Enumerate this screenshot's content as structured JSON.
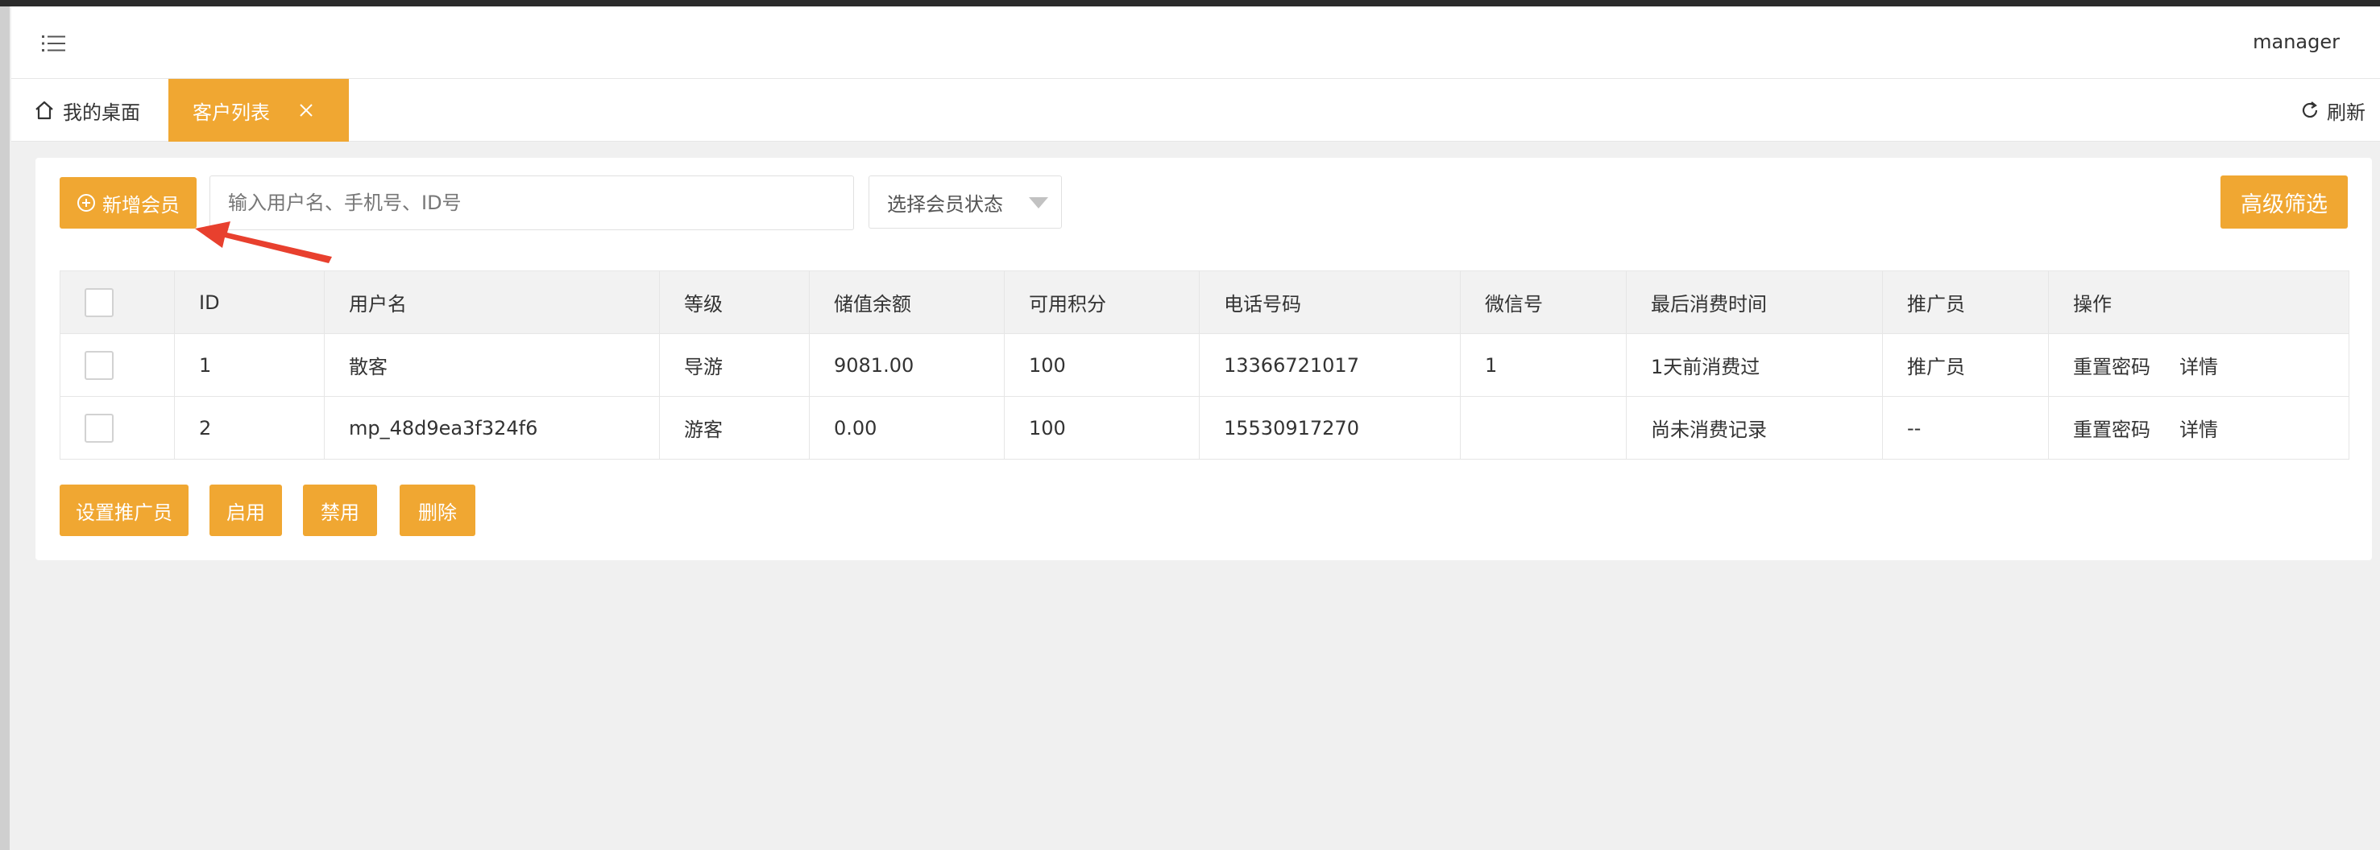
{
  "header": {
    "user_name": "manager",
    "menu_icon": "list-icon"
  },
  "tabs": {
    "home_label": "我的桌面",
    "active_label": "客户列表",
    "refresh_label": "刷新"
  },
  "toolbar": {
    "add_label": "新增会员",
    "search_placeholder": "输入用户名、手机号、ID号",
    "status_placeholder": "选择会员状态",
    "advanced_label": "高级筛选"
  },
  "table": {
    "columns": [
      "ID",
      "用户名",
      "等级",
      "储值余额",
      "可用积分",
      "电话号码",
      "微信号",
      "最后消费时间",
      "推广员",
      "操作"
    ],
    "rows": [
      {
        "id": "1",
        "username": "散客",
        "level": "导游",
        "balance": "9081.00",
        "points": "100",
        "phone": "13366721017",
        "wechat": "1",
        "last_time": "1天前消费过",
        "promoter": "推广员",
        "reset": "重置密码",
        "detail": "详情"
      },
      {
        "id": "2",
        "username": "mp_48d9ea3f324f6",
        "level": "游客",
        "balance": "0.00",
        "points": "100",
        "phone": "15530917270",
        "wechat": "",
        "last_time": "尚未消费记录",
        "promoter": "--",
        "reset": "重置密码",
        "detail": "详情"
      }
    ]
  },
  "bottom": {
    "set_promoter": "设置推广员",
    "enable": "启用",
    "disable": "禁用",
    "delete": "删除"
  },
  "colors": {
    "accent": "#f0a732",
    "annotation": "#e8402e"
  }
}
